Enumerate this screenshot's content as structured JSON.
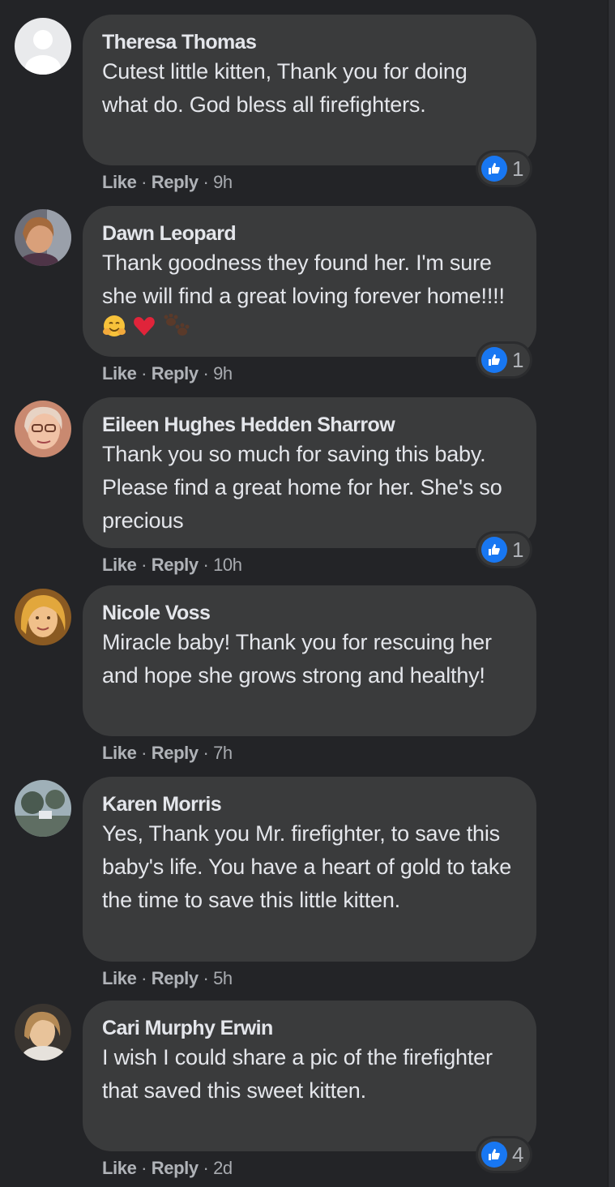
{
  "comments": [
    {
      "author": "Theresa Thomas",
      "text": "Cutest little kitten, Thank you for doing what do. God bless all firefighters.",
      "like_label": "Like",
      "reply_label": "Reply",
      "time": "9h",
      "reactions": "1",
      "avatar": "default-avatar-icon"
    },
    {
      "author": "Dawn Leopard",
      "text": "Thank goodness they found her. I'm sure she will find a great loving forever home!!!!",
      "emojis": [
        "hugging-face-emoji",
        "red-heart-emoji",
        "paw-prints-emoji"
      ],
      "like_label": "Like",
      "reply_label": "Reply",
      "time": "9h",
      "reactions": "1",
      "avatar": "profile-photo"
    },
    {
      "author": "Eileen Hughes Hedden Sharrow",
      "text": "Thank you so much for saving this baby. Please find a great home for her. She's so precious",
      "like_label": "Like",
      "reply_label": "Reply",
      "time": "10h",
      "reactions": "1",
      "avatar": "profile-photo"
    },
    {
      "author": "Nicole Voss",
      "text": "Miracle baby! Thank you for rescuing her and hope she grows strong and healthy!",
      "like_label": "Like",
      "reply_label": "Reply",
      "time": "7h",
      "avatar": "profile-photo"
    },
    {
      "author": "Karen Morris",
      "text": "Yes, Thank you Mr. firefighter, to save this baby's life. You have a heart of gold to take the time to save this little kitten.",
      "like_label": "Like",
      "reply_label": "Reply",
      "time": "5h",
      "avatar": "profile-photo"
    },
    {
      "author": "Cari Murphy Erwin",
      "text": "I wish I could share a pic of the firefighter that saved this sweet kitten.",
      "like_label": "Like",
      "reply_label": "Reply",
      "time": "2d",
      "reactions": "4",
      "avatar": "profile-photo"
    }
  ],
  "separator": "·",
  "colors": {
    "background": "#232427",
    "bubble": "#3a3b3c",
    "text": "#e4e6eb",
    "secondary_text": "#b0b3b8",
    "like_blue": "#1877f2"
  }
}
